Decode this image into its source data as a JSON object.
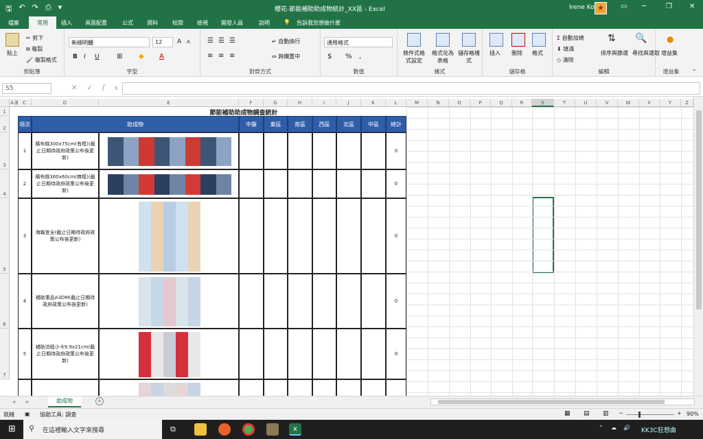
{
  "titlebar": {
    "title": "櫻花-節能補助助成物統計_XX區 - Excel",
    "user": "Irene Ko",
    "icons": [
      "save-icon",
      "undo-icon",
      "redo-icon",
      "print-preview-icon",
      "customize-icon"
    ],
    "ctrl_icons": [
      "ribbon-display-icon",
      "minimize-icon",
      "restore-icon",
      "close-icon"
    ]
  },
  "menu": {
    "tabs": [
      "檔案",
      "常用",
      "插入",
      "頁面配置",
      "公式",
      "資料",
      "校閱",
      "檢視",
      "開發人員",
      "說明"
    ],
    "tell_me": "告訴我您想做什麼"
  },
  "ribbon": {
    "clipboard": {
      "label": "剪貼簿",
      "paste": "貼上",
      "cut": "剪下",
      "copy": "複製",
      "format_painter": "複製格式"
    },
    "font": {
      "label": "字型",
      "font_name": "新細明體",
      "font_size": "12",
      "bold": "B",
      "italic": "I",
      "underline": "U",
      "grow": "A",
      "shrink": "A"
    },
    "alignment": {
      "label": "對齊方式",
      "wrap": "自動換行",
      "merge": "跨欄置中"
    },
    "number": {
      "label": "數值",
      "format": "通用格式",
      "currency": "$",
      "percent": "%",
      "comma": ","
    },
    "styles": {
      "label": "樣式",
      "conditional": "條件式格式設定",
      "format_table": "格式化為表格",
      "cell_styles": "儲存格樣式"
    },
    "cells": {
      "label": "儲存格",
      "insert": "插入",
      "delete": "刪除",
      "format": "格式"
    },
    "editing": {
      "label": "編輯",
      "autosum": "自動加總",
      "fill": "填滿",
      "clear": "清除",
      "sort": "排序與篩選",
      "find": "尋找與選取"
    },
    "addins": {
      "label": "增益集",
      "addin": "增益集"
    }
  },
  "formula_bar": {
    "name_box": "S5",
    "value": ""
  },
  "columns": [
    "A",
    "B",
    "C",
    "D",
    "E",
    "F",
    "G",
    "H",
    "I",
    "J",
    "K",
    "L",
    "M",
    "N",
    "O",
    "P",
    "Q",
    "R",
    "S",
    "T",
    "U",
    "V",
    "W",
    "X",
    "Y",
    "Z"
  ],
  "rows": [
    "1",
    "2",
    "3",
    "4",
    "5",
    "6",
    "7"
  ],
  "sheet": {
    "title": "節能補助助成物調查統計",
    "headers": {
      "no": "項次",
      "item": "助成物",
      "c1": "中盤",
      "c2": "東區",
      "c3": "南區",
      "c4": "西區",
      "c5": "北區",
      "c6": "中區",
      "total": "總計"
    },
    "rows": [
      {
        "no": "1",
        "item": "橫布條300x75cm(有框)(截止日期待政府政策公布後更新)",
        "total": "0"
      },
      {
        "no": "2",
        "item": "橫布條360x60cm(無框)(截止日期待政府政策公布後更新)",
        "total": "0"
      },
      {
        "no": "3",
        "item": "海報宣全(截止日期待政府政策公布後更新)",
        "total": "0"
      },
      {
        "no": "4",
        "item": "補助重品A3DM(截止日期待政府政策公布後更新)",
        "total": "0"
      },
      {
        "no": "5",
        "item": "補助流程小卡9.9x21cm(截止日期待政府政策公布後更新)",
        "total": "0"
      }
    ]
  },
  "tabs": {
    "sheet": "助成物",
    "add": "+"
  },
  "status": {
    "ready": "就緒",
    "accessibility": "協助工具: 調查",
    "zoom": "90%"
  },
  "taskbar": {
    "search": "在這裡輸入文字來搜尋",
    "watermark": "KK3C狂想曲"
  },
  "colors": {
    "excel_green": "#217346",
    "header_blue": "#2f5da8"
  }
}
